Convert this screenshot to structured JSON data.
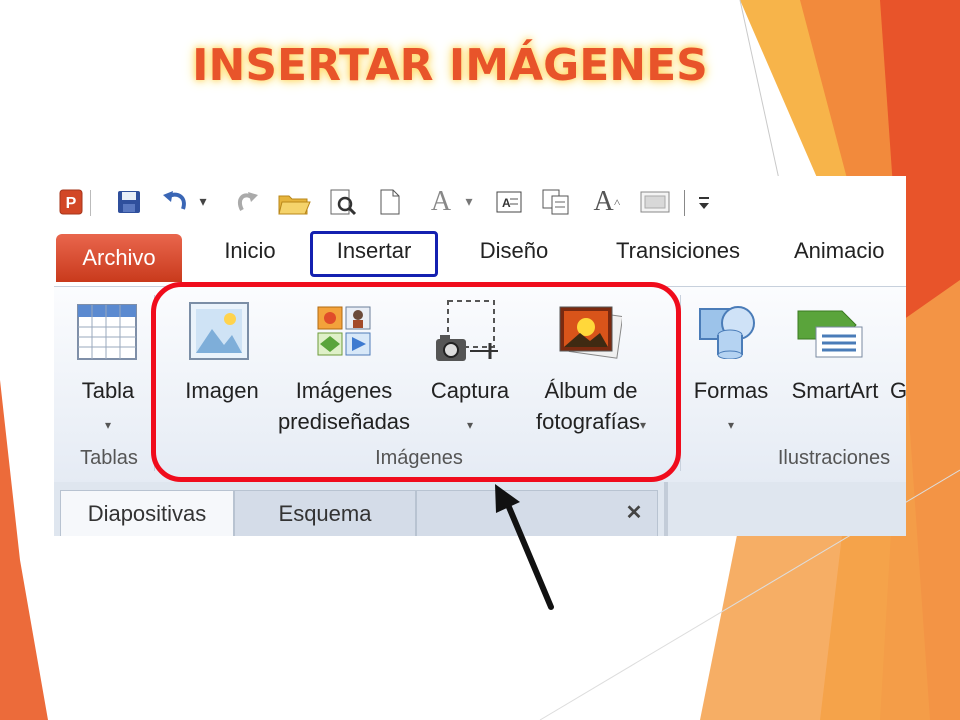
{
  "slide": {
    "title": "INSERTAR IMÁGENES",
    "colors": {
      "title": "#e8542a",
      "title_glow": "#ffd86a",
      "accent_orange": "#f15a24",
      "highlight_red": "#f00c1c",
      "insert_box_blue": "#1420b0"
    }
  },
  "qat": {
    "icons": [
      "powerpoint-logo-icon",
      "save-icon",
      "undo-icon",
      "dropdown-arrow-icon",
      "redo-icon",
      "open-folder-icon",
      "print-preview-icon",
      "new-document-icon",
      "font-a-icon",
      "dropdown-arrow-icon",
      "text-box-icon",
      "copy-icon",
      "font-grow-icon",
      "gallery-icon",
      "customize-qat-icon"
    ]
  },
  "tabs": {
    "archivo": "Archivo",
    "inicio": "Inicio",
    "insertar": "Insertar",
    "diseno": "Diseño",
    "transiciones": "Transiciones",
    "animaciones": "Animacio"
  },
  "ribbon": {
    "tablas": {
      "button": "Tabla",
      "group": "Tablas"
    },
    "imagenes": {
      "group": "Imágenes",
      "imagen": "Imagen",
      "predisenadas_1": "Imágenes",
      "predisenadas_2": "prediseñadas",
      "captura": "Captura",
      "album_1": "Álbum de",
      "album_2": "fotografías"
    },
    "ilustraciones": {
      "formas": "Formas",
      "smartart": "SmartArt",
      "clipped": "G",
      "group": "Ilustraciones"
    }
  },
  "pane": {
    "diapositivas": "Diapositivas",
    "esquema": "Esquema",
    "close": "✕"
  },
  "dropdown_glyph": "▾"
}
